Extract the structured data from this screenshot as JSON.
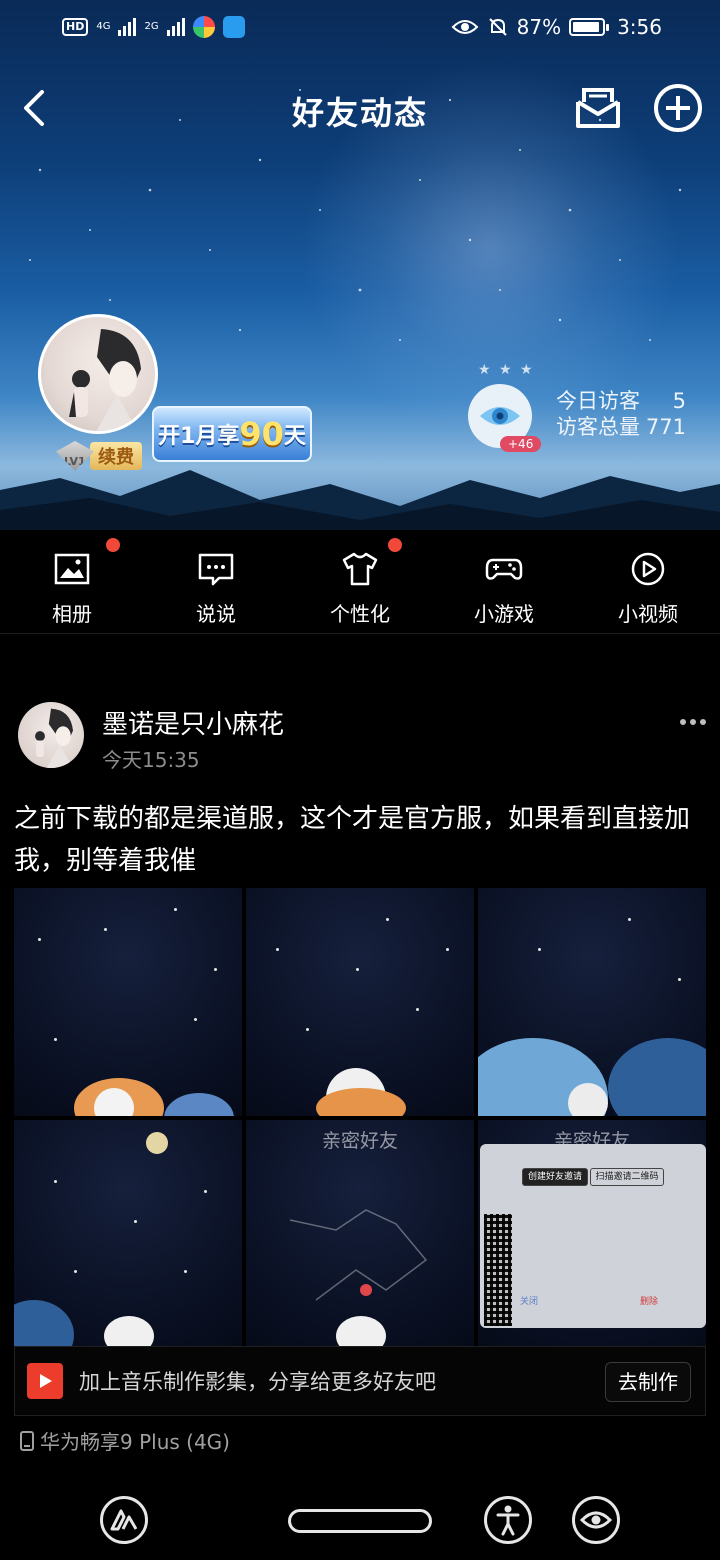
{
  "status_bar": {
    "network_badge": "HD",
    "sig1_label": "4G",
    "sig2_label": "2G",
    "battery": "87%",
    "time": "3:56"
  },
  "header": {
    "title": "好友动态"
  },
  "profile": {
    "level": "LV1",
    "renew_label": "续费",
    "promo_prefix": "开1月享",
    "promo_number": "90",
    "promo_suffix": "天",
    "visitor_plus": "+46",
    "today_visitors_label": "今日访客",
    "today_visitors": "5",
    "total_visitors_label": "访客总量",
    "total_visitors": "771"
  },
  "quicknav": [
    {
      "label": "相册",
      "icon": "photo-album-icon",
      "dot": true
    },
    {
      "label": "说说",
      "icon": "chat-bubble-icon",
      "dot": false
    },
    {
      "label": "个性化",
      "icon": "tshirt-icon",
      "dot": true
    },
    {
      "label": "小游戏",
      "icon": "gamepad-icon",
      "dot": false
    },
    {
      "label": "小视频",
      "icon": "play-circle-icon",
      "dot": false
    }
  ],
  "post": {
    "author": "墨诺是只小麻花",
    "time": "今天15:35",
    "text": "之前下载的都是渠道服，这个才是官方服，如果看到直接加我，别等着我催",
    "image_titles": [
      "",
      "",
      "",
      "",
      "亲密好友",
      "亲密好友"
    ],
    "dialog_tab1": "创建好友邀请",
    "dialog_tab2": "扫描邀请二维码",
    "dialog_close": "关闭",
    "dialog_delete": "删除",
    "music_prompt": "加上音乐制作影集，分享给更多好友吧",
    "make_label": "去制作",
    "device": "华为畅享9 Plus (4G)"
  },
  "colors": {
    "accent_red": "#f0493a",
    "visitor_badge": "#e04a63",
    "music_icon": "#ec3c2c"
  }
}
